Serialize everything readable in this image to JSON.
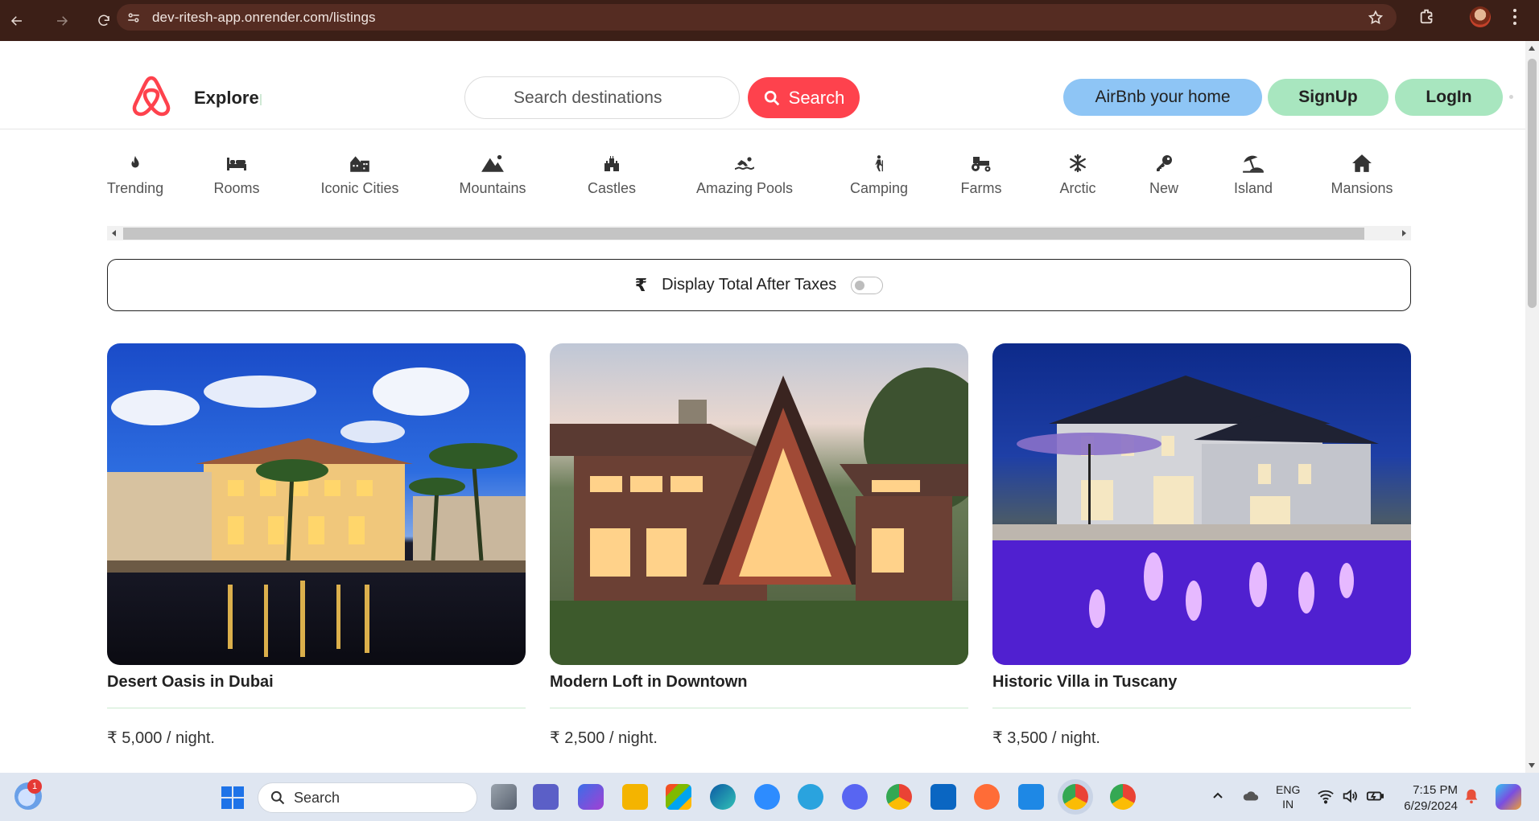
{
  "browser": {
    "url": "dev-ritesh-app.onrender.com/listings"
  },
  "navbar": {
    "brand_label": "Explore",
    "search_placeholder": "Search destinations",
    "search_button_label": "Search",
    "host_button_label": "AirBnb your home",
    "signup_label": "SignUp",
    "login_label": "LogIn"
  },
  "filters": [
    {
      "label": "Trending",
      "icon": "fire-icon"
    },
    {
      "label": "Rooms",
      "icon": "bed-icon"
    },
    {
      "label": "Iconic Cities",
      "icon": "city-icon"
    },
    {
      "label": "Mountains",
      "icon": "mountain-icon"
    },
    {
      "label": "Castles",
      "icon": "castle-icon"
    },
    {
      "label": "Amazing Pools",
      "icon": "swimmer-icon"
    },
    {
      "label": "Camping",
      "icon": "hiker-icon"
    },
    {
      "label": "Farms",
      "icon": "tractor-icon"
    },
    {
      "label": "Arctic",
      "icon": "snowflake-icon"
    },
    {
      "label": "New",
      "icon": "key-icon"
    },
    {
      "label": "Island",
      "icon": "umbrella-beach-icon"
    },
    {
      "label": "Mansions",
      "icon": "house-icon"
    }
  ],
  "tax_toggle": {
    "symbol": "₹",
    "label": "Display Total After Taxes",
    "checked": false
  },
  "listings": [
    {
      "title": "Desert Oasis in Dubai",
      "price": "₹ 5,000 / night."
    },
    {
      "title": "Modern Loft in Downtown",
      "price": "₹ 2,500 / night."
    },
    {
      "title": "Historic Villa in Tuscany",
      "price": "₹ 3,500 / night."
    }
  ],
  "taskbar": {
    "search_label": "Search",
    "notification_count": "1",
    "language_line1": "ENG",
    "language_line2": "IN",
    "time": "7:15 PM",
    "date": "6/29/2024"
  },
  "colors": {
    "brand": "#fe424d",
    "host_pill": "#8ec5f5",
    "auth_pill": "#a8e6bf",
    "chrome_bg": "#3c1f17"
  }
}
